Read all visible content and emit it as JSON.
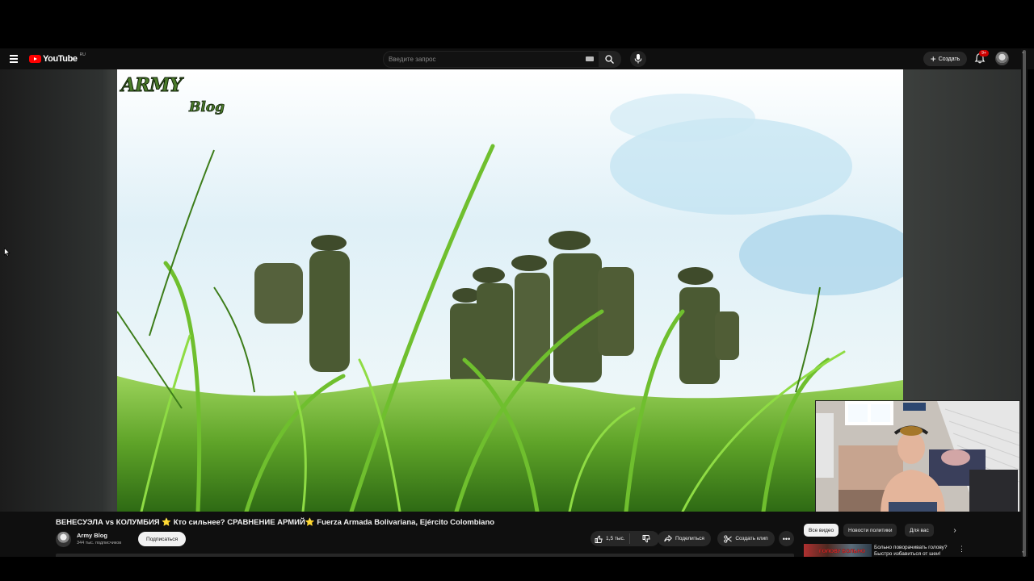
{
  "topbar": {
    "logo_text": "YouTube",
    "logo_region": "RU",
    "search_placeholder": "Введите запрос",
    "create_label": "Создать",
    "notifications_badge": "9+"
  },
  "video": {
    "title": "ВЕНЕСУЭЛА vs КОЛУМБИЯ ⭐ Кто сильнее? СРАВНЕНИЕ АРМИЙ⭐ Fuerza Armada Bolivariana, Ejército Colombiano",
    "watermark_line1": "ARMY",
    "watermark_line2": "Blog"
  },
  "channel": {
    "name": "Army Blog",
    "subscribers": "344 тыс. подписчиков",
    "subscribe_label": "Подписаться"
  },
  "actions": {
    "likes": "1,5 тыс.",
    "share_label": "Поделиться",
    "clip_label": "Создать клип",
    "more_label": "•••"
  },
  "sidebar": {
    "chips": [
      "Все видео",
      "Новости политики",
      "Для вас"
    ],
    "active_chip": "Все видео",
    "recommendation": {
      "thumb_text": "ГОЛОВУ БОЛЬНО",
      "title": "Больно поворачивать голову? Быстро избавиться от шеи!"
    }
  },
  "colors": {
    "background": "#0f0f0f",
    "brand_red": "#ff0000",
    "chip_bg": "#272727",
    "text": "#f1f1f1"
  },
  "icons": [
    "menu-icon",
    "youtube-logo-icon",
    "keyboard-icon",
    "search-icon",
    "mic-icon",
    "plus-icon",
    "bell-icon",
    "like-icon",
    "dislike-icon",
    "share-icon",
    "scissors-icon",
    "chevron-right-icon",
    "kebab-icon"
  ]
}
